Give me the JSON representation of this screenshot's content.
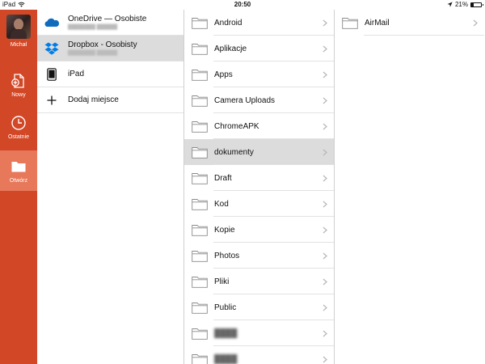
{
  "status_bar": {
    "device": "iPad",
    "time": "20:50",
    "battery": "21%",
    "battery_fraction": 0.21
  },
  "sidebar": {
    "user_name": "Michał",
    "new_label": "Nowy",
    "recent_label": "Ostatnie",
    "open_label": "Otwórz"
  },
  "places": [
    {
      "name": "OneDrive — Osobiste",
      "icon": "onedrive-icon",
      "selected": false
    },
    {
      "name": "Dropbox - Osobisty",
      "icon": "dropbox-icon",
      "selected": true
    },
    {
      "name": "iPad",
      "icon": "ipad-icon",
      "selected": false
    },
    {
      "name": "Dodaj miejsce",
      "icon": "plus-icon",
      "selected": false
    }
  ],
  "folders": [
    {
      "name": "Android"
    },
    {
      "name": "Aplikacje"
    },
    {
      "name": "Apps"
    },
    {
      "name": "Camera Uploads"
    },
    {
      "name": "ChromeAPK"
    },
    {
      "name": "dokumenty",
      "selected": true
    },
    {
      "name": "Draft"
    },
    {
      "name": "Kod"
    },
    {
      "name": "Kopie"
    },
    {
      "name": "Photos"
    },
    {
      "name": "Pliki"
    },
    {
      "name": "Public"
    }
  ],
  "subfolders": [
    {
      "name": "AirMail"
    }
  ],
  "colors": {
    "accent": "#d24726",
    "accent_selected": "#e7785a",
    "selection": "#dcdcdc",
    "onedrive": "#0f6cbd",
    "dropbox": "#007ee5"
  }
}
